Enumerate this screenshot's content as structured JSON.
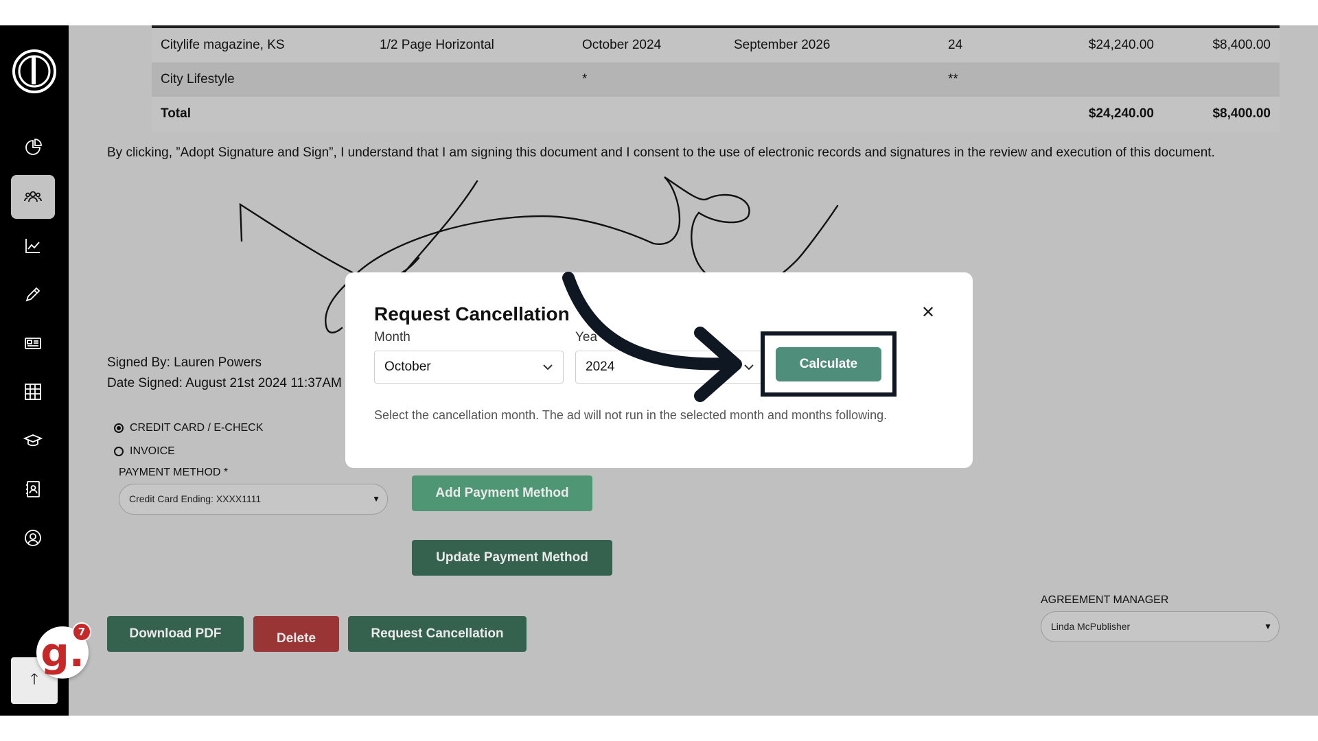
{
  "table": {
    "rows": [
      [
        "Citylife magazine, KS",
        "1/2 Page Horizontal",
        "October 2024",
        "September 2026",
        "24",
        "$24,240.00",
        "$8,400.00"
      ],
      [
        "City Lifestyle",
        "",
        "*",
        "",
        "**",
        "",
        ""
      ]
    ],
    "total": {
      "label": "Total",
      "amount1": "$24,240.00",
      "amount2": "$8,400.00"
    }
  },
  "consent_text": "By clicking, ”Adopt Signature and Sign”, I understand that I am signing this document and I consent to the use of electronic records and signatures in the review and execution of this document.",
  "signed_by": "Signed By: Lauren Powers",
  "date_signed": "Date Signed: August 21st 2024 11:37AM",
  "payment": {
    "options": [
      {
        "label": "CREDIT CARD / E-CHECK",
        "checked": true
      },
      {
        "label": "INVOICE",
        "checked": false
      }
    ],
    "method_label": "PAYMENT METHOD *",
    "method_value": "Credit Card Ending: XXXX1111",
    "add_label": "Add Payment Method",
    "update_label": "Update Payment Method"
  },
  "actions": {
    "download": "Download PDF",
    "delete": "Delete",
    "request_cancellation": "Request Cancellation"
  },
  "agreement_manager": {
    "label": "AGREEMENT MANAGER",
    "value": "Linda McPublisher"
  },
  "badge_count": "7",
  "badge_letter": "g.",
  "modal": {
    "title": "Request Cancellation",
    "month_label": "Month",
    "month_value": "October",
    "year_label": "Yea",
    "year_value": "2024",
    "calculate": "Calculate",
    "help": "Select the cancellation month. The ad will not run in the selected month and months following.",
    "close_symbol": "✕"
  },
  "colors": {
    "sidebar": "#000000",
    "overlay": "#c0c0c0",
    "green_light": "#4f9674",
    "green_dark": "#35614f",
    "red": "#9a3535",
    "calculate": "#4f8e7b",
    "highlight": "#0f1722"
  }
}
